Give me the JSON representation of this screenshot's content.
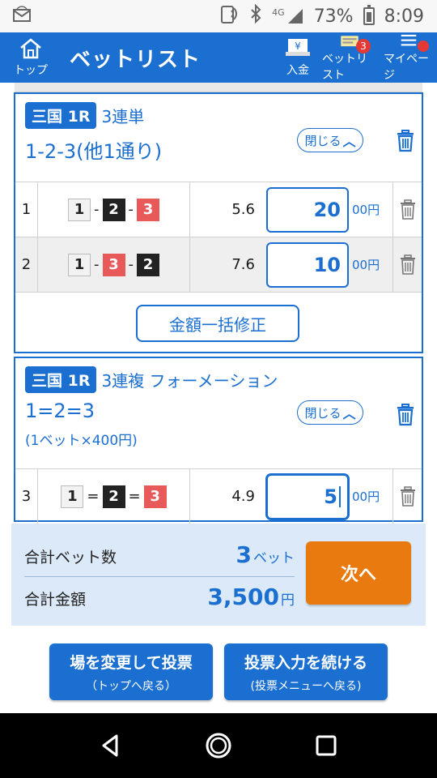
{
  "status_bar": {
    "network": "4G",
    "battery": "73%",
    "time": "8:09"
  },
  "header": {
    "home_label": "トップ",
    "title": "ベットリスト",
    "deposit_label": "入金",
    "betlist_label": "ベットリスト",
    "betlist_badge": "3",
    "mypage_label": "マイページ"
  },
  "bets": [
    {
      "venue": "三国 1R",
      "bet_type": "3連単",
      "combination": "1-2-3(他1通り)",
      "subtitle": "",
      "close_label": "閉じる",
      "rows": [
        {
          "no": "1",
          "boxes": [
            "1",
            "2",
            "3"
          ],
          "separator": "-",
          "odds": "5.6",
          "amount": "20",
          "unit": "00円"
        },
        {
          "no": "2",
          "boxes": [
            "1",
            "3",
            "2"
          ],
          "separator": "-",
          "odds": "7.6",
          "amount": "10",
          "unit": "00円"
        }
      ],
      "bulk_edit_label": "金額一括修正"
    },
    {
      "venue": "三国 1R",
      "bet_type": "3連複 フォーメーション",
      "combination": "1=2=3",
      "subtitle": "(1ベット×400円)",
      "close_label": "閉じる",
      "rows": [
        {
          "no": "3",
          "boxes": [
            "1",
            "2",
            "3"
          ],
          "separator": "=",
          "odds": "4.9",
          "amount": "5",
          "unit": "00円"
        }
      ]
    }
  ],
  "summary": {
    "count_label": "合計ベット数",
    "count_value": "3",
    "count_unit": "ベット",
    "total_label": "合計金額",
    "total_value": "3,500",
    "total_unit": "円",
    "next_label": "次へ"
  },
  "footer": {
    "change_venue_main": "場を変更して投票",
    "change_venue_sub": "（トップへ戻る）",
    "continue_main": "投票入力を続ける",
    "continue_sub": "(投票メニューへ戻る)"
  },
  "colors": {
    "primary": "#1a6fd1",
    "accent_orange": "#e87a10",
    "box_black": "#222222",
    "box_red": "#e85a5a",
    "summary_bg": "#dce9f8"
  }
}
